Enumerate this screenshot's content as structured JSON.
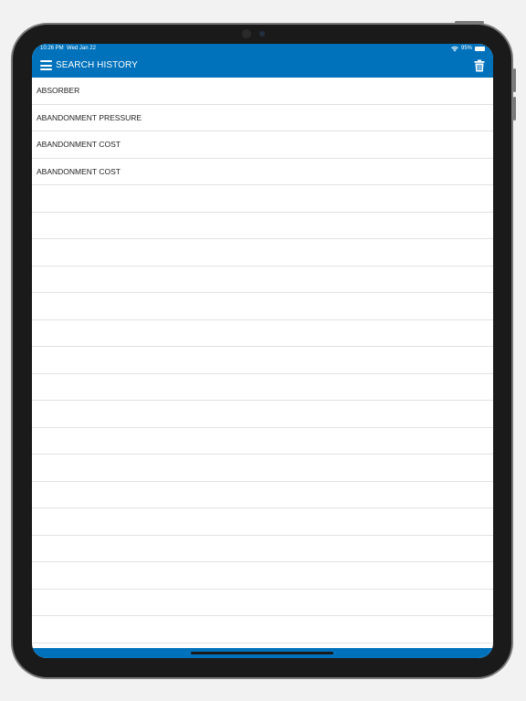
{
  "status": {
    "time": "10:26 PM",
    "date": "Wed Jan 22",
    "battery": "95%",
    "battery_level": 0.95
  },
  "header": {
    "title": "SEARCH HISTORY"
  },
  "history": {
    "items": [
      "ABSORBER",
      "ABANDONMENT PRESSURE",
      "ABANDONMENT COST",
      "ABANDONMENT COST"
    ]
  },
  "colors": {
    "accent": "#0072bc"
  }
}
